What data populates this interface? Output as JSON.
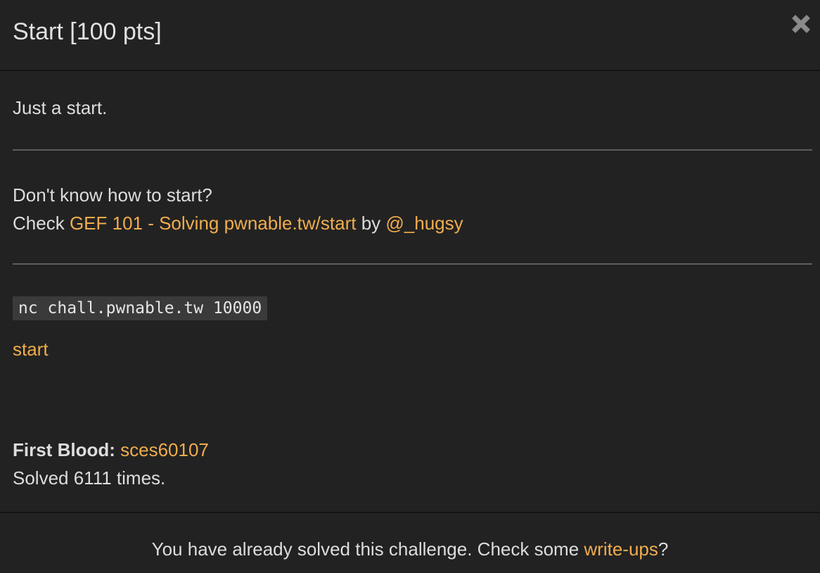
{
  "modal": {
    "title": "Start [100 pts]",
    "close_icon": "close-icon"
  },
  "challenge": {
    "description": "Just a start.",
    "help": {
      "line1": "Don't know how to start?",
      "check_prefix": "Check",
      "guide_link": "GEF 101 - Solving pwnable.tw/start",
      "by_text": "by",
      "author_link": "@_hugsy"
    },
    "connection_command": "nc chall.pwnable.tw 10000",
    "file_link": "start"
  },
  "stats": {
    "first_blood_label": "First Blood:",
    "first_blood_user": "sces60107",
    "solved_text": "Solved 6111 times."
  },
  "footer": {
    "message_prefix": "You have already solved this challenge. Check some",
    "writeups_link": "write-ups",
    "message_suffix": "?"
  },
  "colors": {
    "background": "#222222",
    "text": "#dddddd",
    "accent_link": "#f0ad4e",
    "divider": "#5e5e5e",
    "code_background": "#3a3a3a"
  }
}
